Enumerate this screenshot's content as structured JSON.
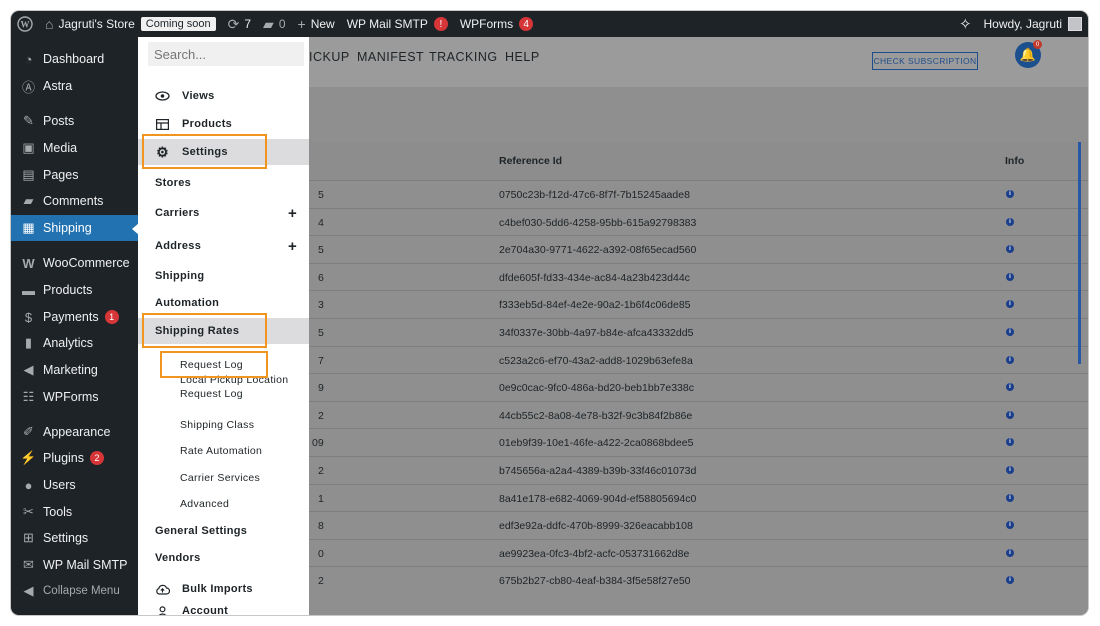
{
  "admin_bar": {
    "site_name": "Jagruti's Store",
    "coming_soon": "Coming soon",
    "updates_count": "7",
    "comments_count": "0",
    "new_label": "New",
    "wp_mail_smtp": "WP Mail SMTP",
    "wp_mail_smtp_badge": "!",
    "wpforms": "WPForms",
    "wpforms_badge": "4",
    "howdy": "Howdy, Jagruti"
  },
  "sidebar": {
    "items": [
      {
        "label": "Dashboard",
        "icon": "dashboard-icon"
      },
      {
        "label": "Astra",
        "icon": "astra-icon"
      },
      {
        "label": "Posts",
        "icon": "pin-icon"
      },
      {
        "label": "Media",
        "icon": "media-icon"
      },
      {
        "label": "Pages",
        "icon": "page-icon"
      },
      {
        "label": "Comments",
        "icon": "comment-icon"
      },
      {
        "label": "Shipping",
        "icon": "grid-icon"
      },
      {
        "label": "WooCommerce",
        "icon": "woo-icon"
      },
      {
        "label": "Products",
        "icon": "archive-icon"
      },
      {
        "label": "Payments",
        "icon": "dollar-icon",
        "badge": "1"
      },
      {
        "label": "Analytics",
        "icon": "bar-chart-icon"
      },
      {
        "label": "Marketing",
        "icon": "megaphone-icon"
      },
      {
        "label": "WPForms",
        "icon": "form-icon"
      },
      {
        "label": "Appearance",
        "icon": "brush-icon"
      },
      {
        "label": "Plugins",
        "icon": "plug-icon",
        "badge": "2"
      },
      {
        "label": "Users",
        "icon": "user-icon"
      },
      {
        "label": "Tools",
        "icon": "wrench-icon"
      },
      {
        "label": "Settings",
        "icon": "sliders-icon"
      },
      {
        "label": "WP Mail SMTP",
        "icon": "mail-icon"
      },
      {
        "label": "Collapse Menu",
        "icon": "collapse-icon"
      }
    ]
  },
  "topnav": {
    "links": [
      "ICKUP",
      "MANIFEST",
      "TRACKING",
      "HELP"
    ],
    "check_subscription": "CHECK SUBSCRIPTION",
    "bell_badge": "0"
  },
  "table": {
    "headers": {
      "reference": "Reference Id",
      "info": "Info"
    },
    "rows": [
      {
        "left": "5",
        "ref": "0750c23b-f12d-47c6-8f7f-7b15245aade8"
      },
      {
        "left": "4",
        "ref": "c4bef030-5dd6-4258-95bb-615a92798383"
      },
      {
        "left": "5",
        "ref": "2e704a30-9771-4622-a392-08f65ecad560"
      },
      {
        "left": "6",
        "ref": "dfde605f-fd33-434e-ac84-4a23b423d44c"
      },
      {
        "left": "3",
        "ref": "f333eb5d-84ef-4e2e-90a2-1b6f4c06de85"
      },
      {
        "left": "5",
        "ref": "34f0337e-30bb-4a97-b84e-afca43332dd5"
      },
      {
        "left": "7",
        "ref": "c523a2c6-ef70-43a2-add8-1029b63efe8a"
      },
      {
        "left": "9",
        "ref": "0e9c0cac-9fc0-486a-bd20-beb1bb7e338c"
      },
      {
        "left": "2",
        "ref": "44cb55c2-8a08-4e78-b32f-9c3b84f2b86e"
      },
      {
        "left": "09",
        "ref": "01eb9f39-10e1-46fe-a422-2ca0868bdee5"
      },
      {
        "left": "2",
        "ref": "b745656a-a2a4-4389-b39b-33f46c01073d"
      },
      {
        "left": "1",
        "ref": "8a41e178-e682-4069-904d-ef58805694c0"
      },
      {
        "left": "8",
        "ref": "edf3e92a-ddfc-470b-8999-326eacabb108"
      },
      {
        "left": "0",
        "ref": "ae9923ea-0fc3-4bf2-acfc-053731662d8e"
      },
      {
        "left": "2",
        "ref": "675b2b27-cb80-4eaf-b384-3f5e58f27e50"
      }
    ]
  },
  "flyout": {
    "search_placeholder": "Search...",
    "views": "Views",
    "products": "Products",
    "settings": "Settings",
    "stores": "Stores",
    "carriers": "Carriers",
    "address": "Address",
    "shipping": "Shipping",
    "automation": "Automation",
    "shipping_rates": "Shipping Rates",
    "request_log": "Request Log",
    "local_pickup_1": "Local Pickup Location",
    "local_pickup_2": "Request Log",
    "shipping_class": "Shipping Class",
    "rate_automation": "Rate Automation",
    "carrier_services": "Carrier Services",
    "advanced": "Advanced",
    "general_settings": "General Settings",
    "vendors": "Vendors",
    "bulk_imports": "Bulk Imports",
    "account": "Account",
    "plus_symbol": "+"
  }
}
